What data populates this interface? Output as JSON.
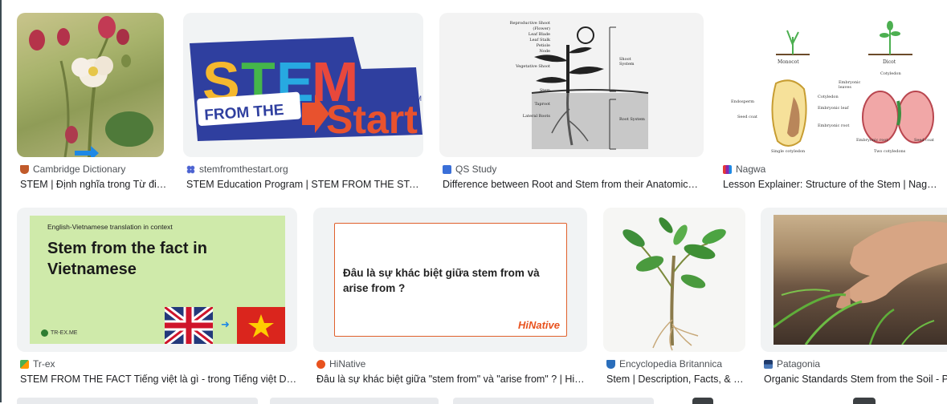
{
  "results": [
    {
      "source": "Cambridge Dictionary",
      "title": "STEM | Định nghĩa trong Từ điển",
      "favicon": "cambridge-shield-icon"
    },
    {
      "source": "stemfromthestart.org",
      "title": "STEM Education Program | STEM FROM THE START",
      "favicon": "stem-dots-icon"
    },
    {
      "source": "QS Study",
      "title": "Difference between Root and Stem from their Anatomica…",
      "favicon": "qs-study-icon"
    },
    {
      "source": "Nagwa",
      "title": "Lesson Explainer: Structure of the Stem | Nagwa",
      "favicon": "nagwa-icon"
    },
    {
      "source": "Tr-ex",
      "title": "STEM FROM THE FACT Tiếng việt là gì - trong Tiếng việt Dịch",
      "favicon": "trex-icon"
    },
    {
      "source": "HiNative",
      "title": "Đâu là sự khác biệt giữa \"stem from\" và \"arise from\" ? | HiN…",
      "favicon": "hinative-icon"
    },
    {
      "source": "Encyclopedia Britannica",
      "title": "Stem | Description, Facts, & …",
      "favicon": "britannica-icon"
    },
    {
      "source": "Patagonia",
      "title": "Organic Standards Stem from the Soil - Pa",
      "favicon": "patagonia-icon"
    }
  ],
  "stem_logo": {
    "line1": "STEM",
    "line2": "FROM THE",
    "line3": "Start",
    "tm": "TM"
  },
  "diagram_qs": {
    "labels_left": [
      "Reproductive Shoot (Flower)",
      "Leaf Blade",
      "Leaf Stalk",
      "Petiole",
      "Node",
      "Vegetative Shoot",
      "Bud",
      "Stem",
      "Taproot",
      "Lateral Roots"
    ],
    "labels_right": [
      "Shoot System",
      "Root System"
    ]
  },
  "diagram_nagwa": {
    "monocot": "Monocot",
    "dicot": "Dicot",
    "endosperm": "Endosperm",
    "seed_coat": "Seed coat",
    "cotyledon": "Cotyledon",
    "embryonic_leaf": "Embryonic leaf",
    "embryonic_root": "Embryonic root",
    "embryonic_leaves": "Embryonic leaves",
    "cotyledon_right": "Cotyledon",
    "embryonic_root_right": "Embryonic root",
    "seed_coat_right": "Seed coat",
    "single_cotyledon": "Single cotyledon",
    "two_cotyledons": "Two cotyledons"
  },
  "trex_card": {
    "context": "English-Vietnamese translation in context",
    "heading": "Stem from the fact in Vietnamese",
    "brand": "TR-EX.ME"
  },
  "hinative_card": {
    "question": "Đâu là sự khác biệt giữa stem from và arise from ?",
    "brand": "HiNative"
  },
  "colors": {
    "trex_bg": "#cfeaaa",
    "hinative_border": "#e0602b",
    "hinative_brand": "#e8521e",
    "stem_blue": "#2f3f9f",
    "accent_blue": "#1a73e8"
  }
}
